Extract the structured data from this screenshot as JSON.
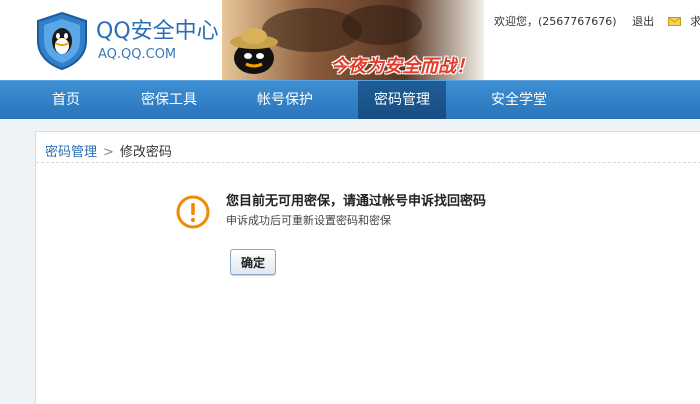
{
  "header": {
    "site_title": "QQ安全中心",
    "site_domain": "AQ.QQ.COM",
    "banner_slogan": "今夜为安全而战！",
    "welcome_text": "欢迎您，(2567767676)",
    "logout_label": "退出",
    "help_label": "求助"
  },
  "nav": {
    "items": [
      {
        "label": "首页"
      },
      {
        "label": "密保工具"
      },
      {
        "label": "帐号保护"
      },
      {
        "label": "密码管理",
        "active": true
      },
      {
        "label": "安全学堂"
      }
    ]
  },
  "breadcrumb": {
    "parent": "密码管理",
    "separator": ">",
    "current": "修改密码"
  },
  "message": {
    "title": "您目前无可用密保，请通过帐号申诉找回密码",
    "subtitle": "申诉成功后可重新设置密码和密保",
    "confirm_label": "确定",
    "icon": "warning-icon"
  },
  "colors": {
    "nav_bg": "#2a74bb",
    "nav_active": "#174d82",
    "brand_blue": "#2a6fb5",
    "warning_orange": "#f08a00"
  }
}
